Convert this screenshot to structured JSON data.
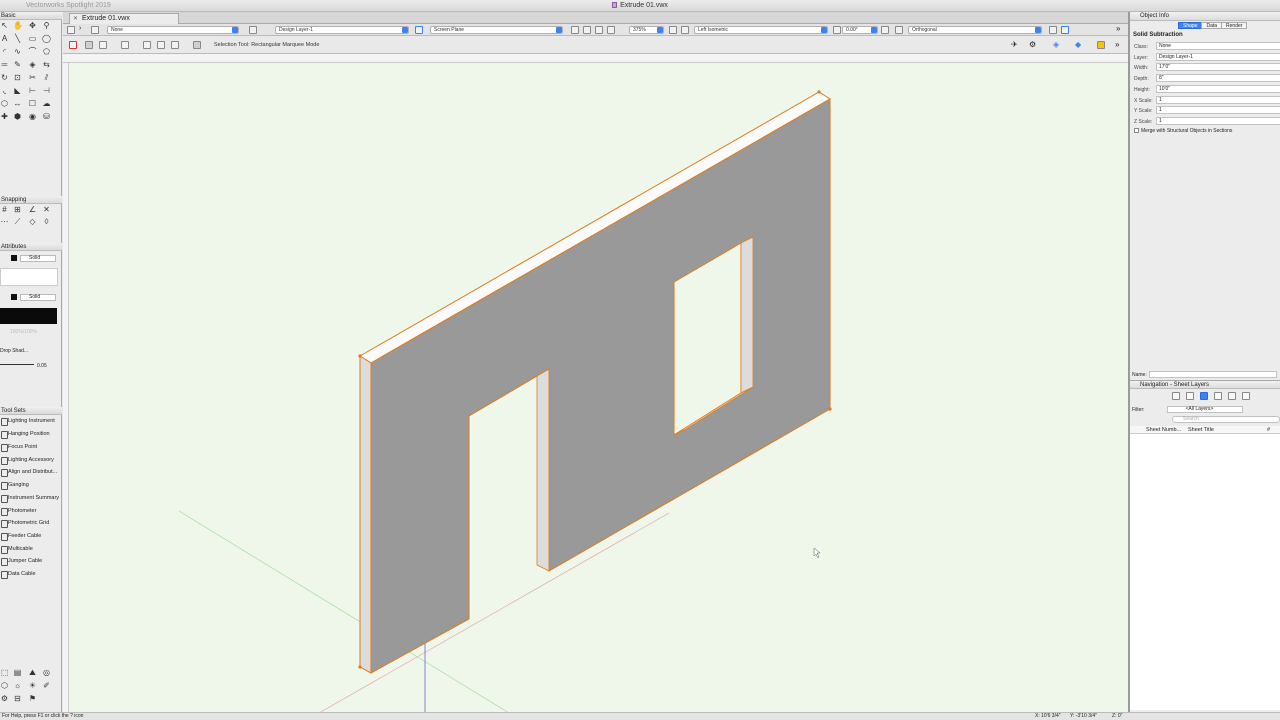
{
  "window": {
    "app_title": "Vectorworks Spotlight 2019",
    "doc_title": "Extrude 01.vwx",
    "tab_label": "Extrude 01.vwx"
  },
  "palettes": {
    "basic_title": "Basic",
    "snapping_title": "Snapping",
    "attributes_title": "Attributes",
    "fill_style": "Solid",
    "pen_style": "Solid",
    "opacity": "100%/100%",
    "drop_shadow": "Drop Shad...",
    "line_weight": "0.05",
    "tool_sets_title": "Tool Sets",
    "tool_sets": [
      "Lighting Instrument",
      "Hanging Position",
      "Focus Point",
      "Lighting Accessory",
      "Align and Distribut...",
      "Ganging",
      "Instrument Summary",
      "Photometer",
      "Photometric Grid",
      "Feeder Cable",
      "Multicable",
      "Jumper Cable",
      "Data Cable"
    ]
  },
  "view_bar": {
    "class": "None",
    "layer": "Design Layer-1",
    "plane": "Screen Plane",
    "zoom": "375%",
    "view": "Left Isometric",
    "rotation": "0.00°",
    "projection": "Orthogonal"
  },
  "mode_bar": {
    "text": "Selection Tool: Rectangular Marquee Mode"
  },
  "object_info": {
    "panel_title": "Object Info",
    "tabs": [
      {
        "label": "Shape",
        "active": true
      },
      {
        "label": "Data",
        "active": false
      },
      {
        "label": "Render",
        "active": false
      }
    ],
    "object_type": "Solid Subtraction",
    "fields": [
      {
        "label": "Class:",
        "value": "None"
      },
      {
        "label": "Layer:",
        "value": "Design Layer-1"
      },
      {
        "label": "Width:",
        "value": "17'0\""
      },
      {
        "label": "Depth:",
        "value": "8\""
      },
      {
        "label": "Height:",
        "value": "10'0\""
      },
      {
        "label": "X Scale:",
        "value": "1"
      },
      {
        "label": "Y Scale:",
        "value": "1"
      },
      {
        "label": "Z Scale:",
        "value": "1"
      }
    ],
    "merge_label": "Merge with Structural Objects in Sections",
    "name_label": "Name:"
  },
  "navigation": {
    "panel_title": "Navigation - Sheet Layers",
    "filter_label": "Filter:",
    "filter_value": "<All Layers>",
    "search_placeholder": "Search",
    "columns": [
      "Sheet Numb...",
      "Sheet Title",
      "#"
    ]
  },
  "status": {
    "help_text": "For Help, press F1 or click the ? icon",
    "coord_x": "X: 10'6 3/4\"",
    "coord_y": "Y: -3'10 3/4\"",
    "coord_z": "Z: 0\""
  },
  "colors": {
    "canvas_bg": "#eff6ea",
    "wall_face": "#999999",
    "wall_top": "#fbfbfb",
    "wall_side": "#dcdcdc",
    "selection_orange": "#e07b1a",
    "accent_blue": "#3b82f6"
  }
}
